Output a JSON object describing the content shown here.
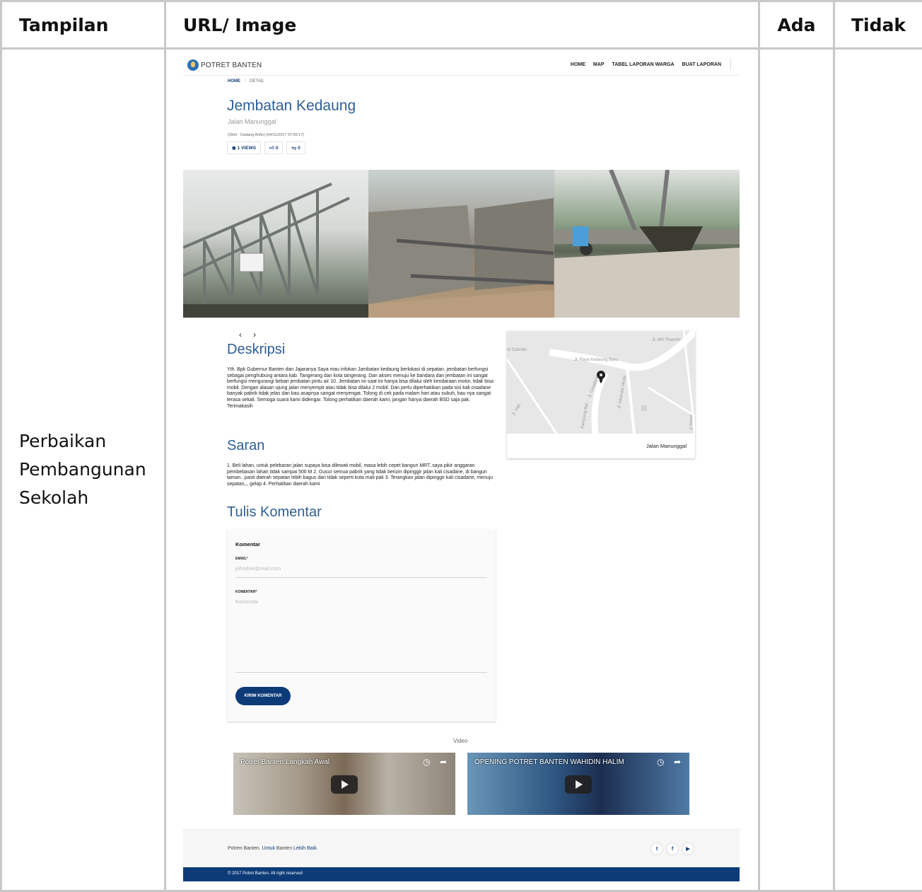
{
  "table": {
    "headers": [
      "Tampilan",
      "URL/ Image",
      "Ada",
      "Tidak"
    ],
    "row_label": "Perbaikan Pembangunan Sekolah"
  },
  "site": {
    "brand": "POTRET BANTEN",
    "menu": [
      "HOME",
      "MAP",
      "TABEL LAPORAN WARGA",
      "BUAT LAPORAN"
    ],
    "breadcrumb": {
      "home": "HOME",
      "sep": "/",
      "current": "DETAIL"
    },
    "title": "Jembatan Kedaung",
    "subtitle": "Jalan Manunggal",
    "meta": "(Oleh : Dadang Arifin) (04/11/2017 07:56:17)",
    "views": "1 VIEWS",
    "likes": "0",
    "dislikes": "0",
    "carousel_prev": "‹",
    "carousel_next": "›",
    "deskripsi_heading": "Deskripsi",
    "deskripsi_text": "Yth. Bpk Gubernur Banten dan Jajaranya Saya mau infokan Jambatan kedaung berlokasi di sepatan, jembatan berfungsi sebagai penghubung antara kab. Tangerang dan kota tangerang. Dan akses menuju ke bandara dan jembatan ini sangat berfungsi mengurangi beban jembatan pintu air 10. Jembatan ini saat ini hanya bisa dilalui oleh kendaraan motor, tidak bisa mobil. Dengan alasan ujung jalan menyempit atau tidak bisa dilalui 2 mobil. Dan perlu diperhatiikan pada sisi kali cisadane banyak pabrik tidak jelas dan bau asapnya sangat menyengat. Tolong di cek pada malam hari atau subuh, bau nya sangat terasa sekali. Semoga suara kami didengar. Tolong perhatikan daerah kami, jangan hanya daerah BSD saja pak. Terimakasih",
    "saran_heading": "Saran",
    "saran_text": "1. Beli lahan, untuk pelebaran jalan supaya bisa dilewati mobil, masa lebih cepet bangun MRT..saya pikir anggaran pembebasan lahan tidak sampai 500 M 2. Gusur semua pabrik yang tidak berizin dipinggir jalan kali cisadane, di bangun taman.. pasti daerah sepatan lebih bagus dan tidak seperti kota mati pak 3. Terangkan jalan dipinggir kali cisadane, menuju sepatan,,, gelap 4. Perhatikan daerah kami",
    "map": {
      "caption": "Jalan Manunggal",
      "streets": [
        "Jl. MH Thamrin",
        "Jl. Raya Kedaung Baru",
        "Jl. Iskandar Muda",
        "Jl. Cisadane",
        "Kampung Bar..",
        "Jl. Haji...",
        "ot Subroto",
        "Jl. Ransel"
      ]
    },
    "comment": {
      "heading": "Tulis Komentar",
      "form_title": "Komentar",
      "email_label": "EMAIL*",
      "email_placeholder": "johndoe@mail.com",
      "komentar_label": "KOMENTAR*",
      "komentar_placeholder": "Komentar",
      "submit": "KIRIM KOMENTAR"
    },
    "video_label": "Video",
    "videos": [
      {
        "title": "Potret Banten Langkah Awal"
      },
      {
        "title": "OPENING POTRET BANTEN WAHIDIN HALIM"
      }
    ],
    "footer": {
      "p1": "Potren Banten. ",
      "p2": "Untuk",
      "p3": " Banten ",
      "p4": "Lebih Baik",
      "p5": ".",
      "social": [
        "twitter-icon",
        "facebook-icon",
        "youtube-icon"
      ],
      "copyright": "© 2017 Potret Banten. All right reserved"
    }
  }
}
